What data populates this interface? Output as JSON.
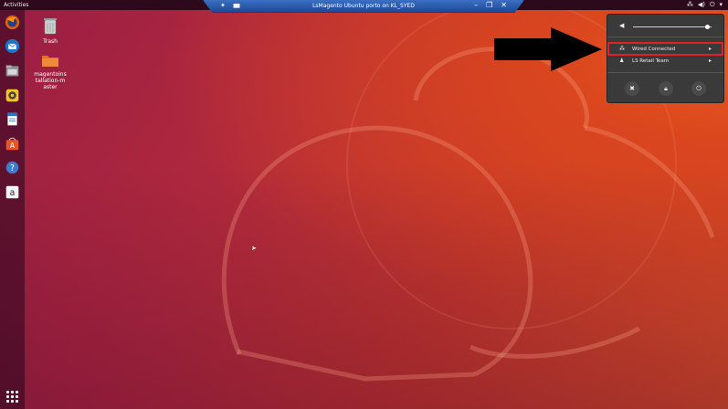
{
  "topbar": {
    "activities_label": "Activities",
    "tray_icons": [
      "network-icon",
      "volume-icon",
      "power-icon",
      "chevron-down-icon"
    ]
  },
  "remote_bar": {
    "title": "LsMagento Ubuntu porto on KL_SYED",
    "controls": [
      "pin-icon",
      "minimize-icon",
      "restore-icon",
      "close-icon"
    ]
  },
  "dock": {
    "items": [
      "firefox",
      "thunderbird",
      "files",
      "rhythmbox",
      "libreoffice-writer",
      "ubuntu-software",
      "help",
      "amazon",
      "show-applications"
    ]
  },
  "desktop": {
    "icons": [
      {
        "name": "trash",
        "label": "Trash"
      },
      {
        "name": "folder",
        "label": "magentoins tallation-master"
      }
    ]
  },
  "system_menu": {
    "volume_level": 0.95,
    "network_label": "Wired Connected",
    "user_label": "LS Retail Team",
    "actions": [
      "settings-icon",
      "lock-icon",
      "power-icon"
    ]
  },
  "colors": {
    "highlight": "#e0212b",
    "menu_bg": "#3a3a3a",
    "topbar_bg": "#2c0a1c",
    "remote_bar": "#2a5bb0"
  }
}
